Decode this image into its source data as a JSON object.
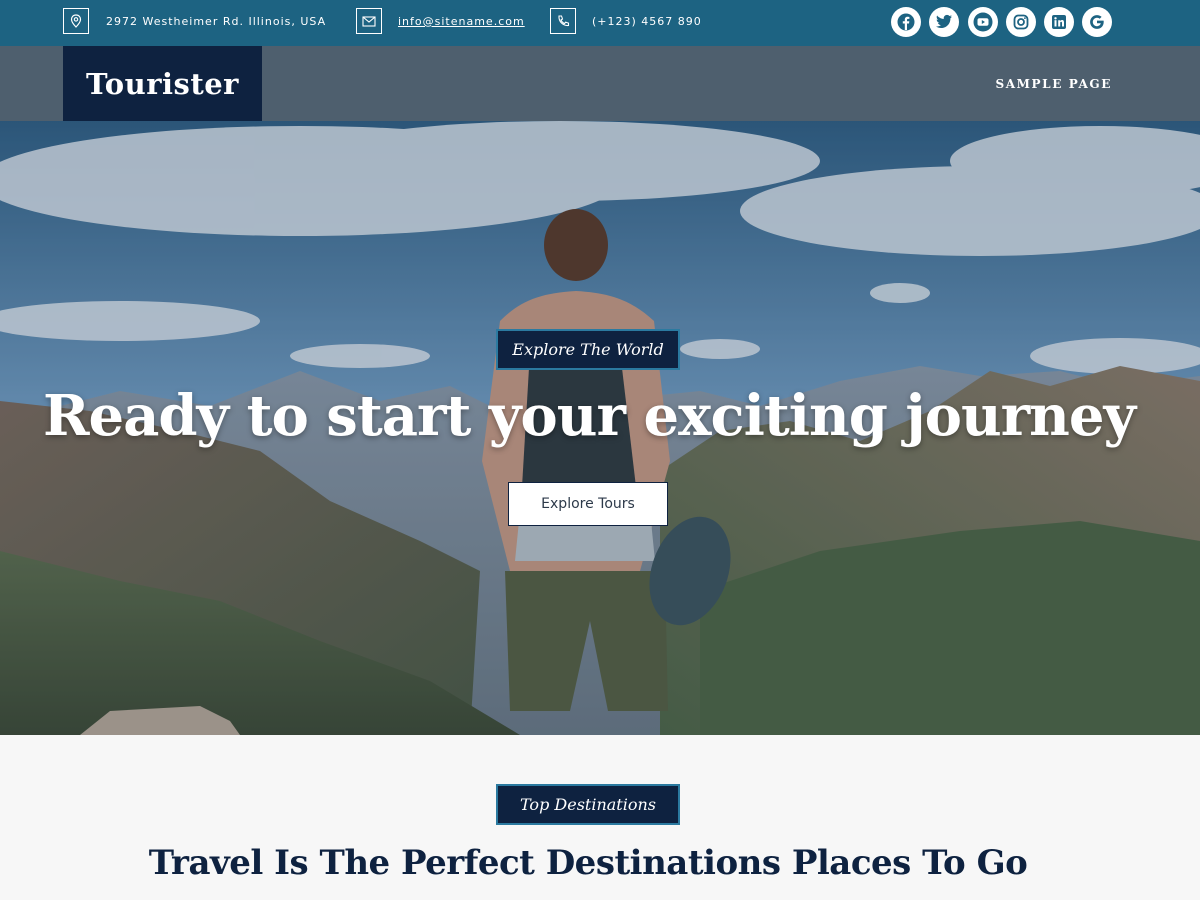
{
  "topbar": {
    "address": "2972 Westheimer Rd. Illinois, USA",
    "email": "info@sitename.com",
    "phone": "(+123) 4567 890",
    "icons": [
      "map-pin-icon",
      "envelope-icon",
      "phone-icon"
    ],
    "socials": [
      "facebook",
      "twitter",
      "youtube",
      "instagram",
      "linkedin",
      "google"
    ]
  },
  "header": {
    "logo": "Tourister",
    "nav": [
      "SAMPLE PAGE"
    ]
  },
  "hero": {
    "tag": "Explore The World",
    "title": "Ready to start your exciting journey",
    "button": "Explore Tours"
  },
  "destinations": {
    "tag": "Top Destinations",
    "title": "Travel Is The Perfect Destinations Places To Go"
  },
  "colors": {
    "topbar": "#1d6382",
    "header": "#4e5f6e",
    "navy": "#0e2240",
    "accent_border": "#2b7aa0"
  }
}
